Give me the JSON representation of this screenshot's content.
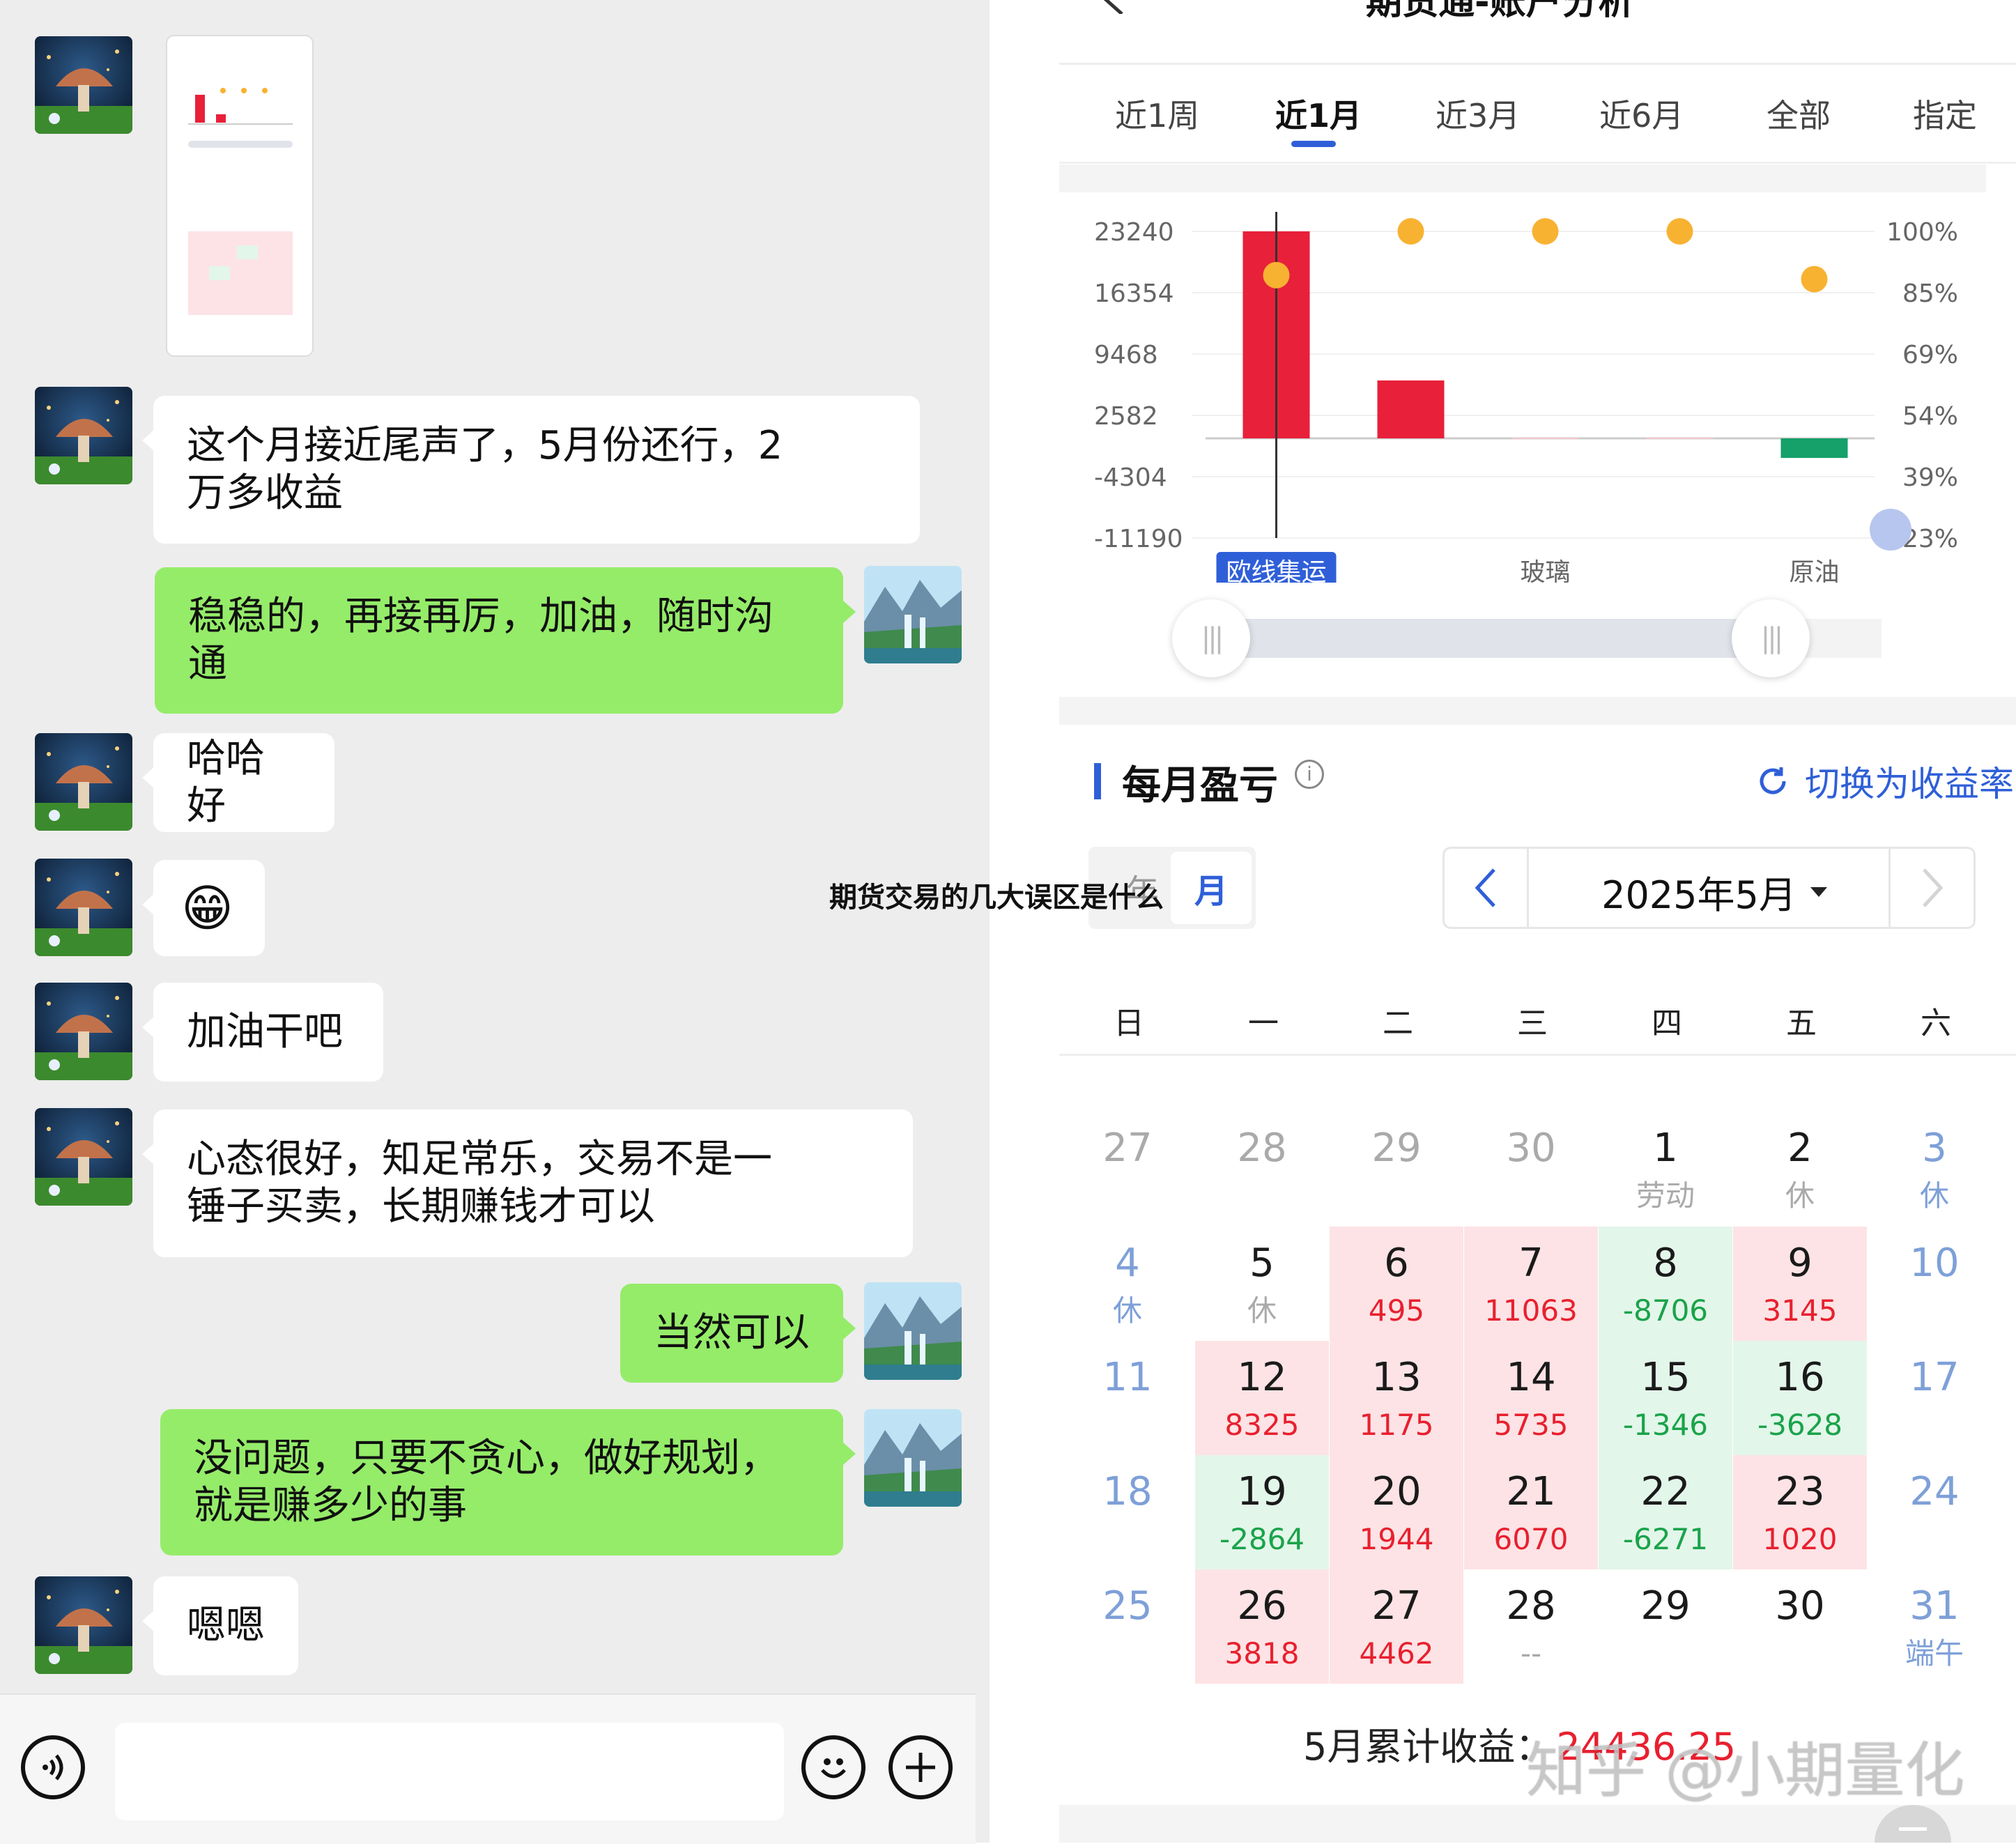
{
  "overlay_title": "期货交易的几大误区是什么",
  "watermark": "知乎 @小期量化",
  "chat": {
    "messages": [
      {
        "side": "in",
        "type": "image"
      },
      {
        "side": "in",
        "text": "这个月接近尾声了，5月份还行，2\n万多收益"
      },
      {
        "side": "out",
        "text": "稳稳的，再接再厉，加油，随时沟\n通"
      },
      {
        "side": "in",
        "text": "哈哈好"
      },
      {
        "side": "in",
        "type": "emoji",
        "text": "😁"
      },
      {
        "side": "in",
        "text": "加油干吧"
      },
      {
        "side": "in",
        "text": "心态很好，知足常乐，交易不是一\n锤子买卖，长期赚钱才可以"
      },
      {
        "side": "out",
        "text": "当然可以"
      },
      {
        "side": "out",
        "text": "没问题，只要不贪心，做好规划，\n就是赚多少的事"
      },
      {
        "side": "in",
        "text": "嗯嗯"
      }
    ],
    "input": {
      "value": "",
      "voice_icon": "voice-icon",
      "emoji_icon": "emoji-icon",
      "plus_icon": "plus-icon"
    }
  },
  "app": {
    "header_title": "期货通-账户分析",
    "tabs": [
      "近1周",
      "近1月",
      "近3月",
      "近6月",
      "全部",
      "指定"
    ],
    "active_tab": 1,
    "chart_data": {
      "type": "bar",
      "categories": [
        "欧线集运",
        "",
        "玻璃",
        "",
        "原油"
      ],
      "visible_category_labels": [
        "欧线集运",
        "玻璃",
        "原油"
      ],
      "values": [
        23240,
        6500,
        0,
        0,
        -2200
      ],
      "ratio_points": [
        89,
        100,
        100,
        100,
        88
      ],
      "left_axis_ticks": [
        "23240",
        "16354",
        "9468",
        "2582",
        "-4304",
        "-11190"
      ],
      "right_axis_ticks": [
        "100%",
        "85%",
        "69%",
        "54%",
        "39%",
        "23%"
      ],
      "ylim": [
        -11190,
        23240
      ],
      "y2lim": [
        23,
        100
      ],
      "colors": {
        "positive": "#e8203a",
        "negative": "#16a06a",
        "point": "#f8b232"
      }
    },
    "monthly": {
      "title": "每月盈亏",
      "switch_label": "切换为收益率",
      "segment": [
        "年",
        "月"
      ],
      "month_label": "2025年5月",
      "weekdays": [
        "日",
        "一",
        "二",
        "三",
        "四",
        "五",
        "六"
      ],
      "weeks": [
        [
          {
            "d": "27",
            "s": "prev"
          },
          {
            "d": "28",
            "s": "prev"
          },
          {
            "d": "29",
            "s": "prev"
          },
          {
            "d": "30",
            "s": "prev"
          },
          {
            "d": "1",
            "v": "劳动",
            "s": "holiday"
          },
          {
            "d": "2",
            "v": "休",
            "s": "holiday"
          },
          {
            "d": "3",
            "v": "休",
            "s": "weekend"
          }
        ],
        [
          {
            "d": "4",
            "v": "休",
            "s": "weekend"
          },
          {
            "d": "5",
            "v": "休",
            "s": "holiday"
          },
          {
            "d": "6",
            "v": "495",
            "s": "red"
          },
          {
            "d": "7",
            "v": "11063",
            "s": "red"
          },
          {
            "d": "8",
            "v": "-8706",
            "s": "green"
          },
          {
            "d": "9",
            "v": "3145",
            "s": "red"
          },
          {
            "d": "10",
            "s": "weekend"
          }
        ],
        [
          {
            "d": "11",
            "s": "weekend"
          },
          {
            "d": "12",
            "v": "8325",
            "s": "red"
          },
          {
            "d": "13",
            "v": "1175",
            "s": "red"
          },
          {
            "d": "14",
            "v": "5735",
            "s": "red"
          },
          {
            "d": "15",
            "v": "-1346",
            "s": "green"
          },
          {
            "d": "16",
            "v": "-3628",
            "s": "green"
          },
          {
            "d": "17",
            "s": "weekend"
          }
        ],
        [
          {
            "d": "18",
            "s": "weekend"
          },
          {
            "d": "19",
            "v": "-2864",
            "s": "green"
          },
          {
            "d": "20",
            "v": "1944",
            "s": "red"
          },
          {
            "d": "21",
            "v": "6070",
            "s": "red"
          },
          {
            "d": "22",
            "v": "-6271",
            "s": "green"
          },
          {
            "d": "23",
            "v": "1020",
            "s": "red"
          },
          {
            "d": "24",
            "s": "weekend"
          }
        ],
        [
          {
            "d": "25",
            "s": "weekend"
          },
          {
            "d": "26",
            "v": "3818",
            "s": "red"
          },
          {
            "d": "27",
            "v": "4462",
            "s": "red"
          },
          {
            "d": "28",
            "v": "--",
            "s": "none"
          },
          {
            "d": "29",
            "s": "none"
          },
          {
            "d": "30",
            "s": "none"
          },
          {
            "d": "31",
            "v": "端午",
            "s": "weekend"
          }
        ]
      ],
      "total_label": "5月累计收益：",
      "total_value": "24436.25"
    }
  }
}
